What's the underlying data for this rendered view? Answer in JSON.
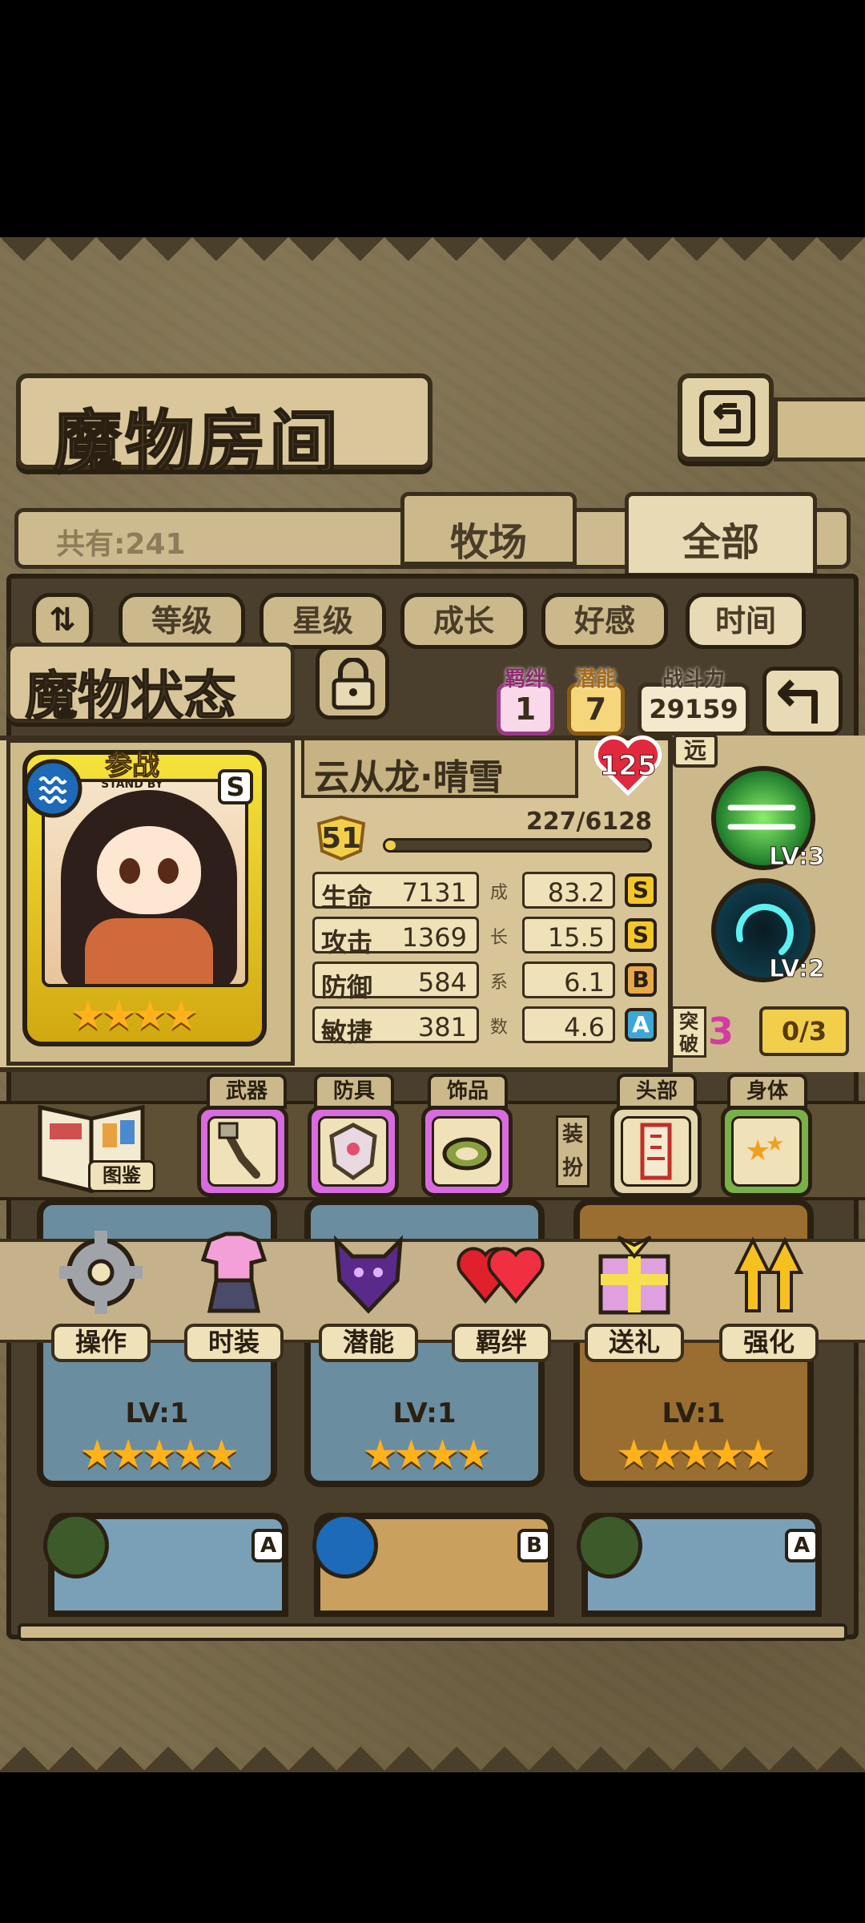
{
  "header": {
    "title": "魔物房间"
  },
  "collection": {
    "count_label": "共有:241"
  },
  "tabs": [
    {
      "label": "牧场"
    },
    {
      "label": "全部"
    }
  ],
  "sort": {
    "options": [
      "等级",
      "星级",
      "成长",
      "好感",
      "时间"
    ],
    "active": "时间"
  },
  "status": {
    "title": "魔物状态",
    "bond_label": "羁绊",
    "bond_value": "1",
    "potential_label": "潜能",
    "potential_value": "7",
    "power_label": "战斗力",
    "power_value": "29159"
  },
  "monster": {
    "name": "云从龙·晴雪",
    "affection": "125",
    "level": "51",
    "exp": "227/6128",
    "exp_fraction": 0.037,
    "standby_label": "参战",
    "standby_sub": "STAND BY",
    "rank": "S",
    "stars": "★★★★",
    "range": "远",
    "stats": [
      {
        "name": "生命",
        "value": "7131",
        "growth": "83.2",
        "grade": "S"
      },
      {
        "name": "攻击",
        "value": "1369",
        "growth": "15.5",
        "grade": "S"
      },
      {
        "name": "防御",
        "value": "584",
        "growth": "6.1",
        "grade": "B"
      },
      {
        "name": "敏捷",
        "value": "381",
        "growth": "4.6",
        "grade": "A"
      }
    ],
    "growth_label_chars": [
      "成",
      "长",
      "系",
      "数"
    ],
    "skills": [
      {
        "level": "LV:3"
      },
      {
        "level": "LV:2"
      }
    ],
    "breakthrough": {
      "label": "突破",
      "value": "3",
      "progress": "0/3"
    }
  },
  "equipment": {
    "book_label": "图鉴",
    "slots": [
      "武器",
      "防具",
      "饰品"
    ],
    "outfit_label": "装扮",
    "outfit_slots": [
      "头部",
      "身体"
    ]
  },
  "actions": [
    "操作",
    "时装",
    "潜能",
    "羁绊",
    "送礼",
    "强化"
  ],
  "list": {
    "cards": [
      {
        "level": "LV:1",
        "stars": "★★★★★"
      },
      {
        "level": "LV:1",
        "stars": "★★★★"
      },
      {
        "level": "LV:1",
        "stars": "★★★★★"
      }
    ],
    "bottom_ranks": [
      "A",
      "B",
      "A"
    ]
  },
  "colors": {
    "accent_gold": "#f3c62a",
    "panel": "#d7c597",
    "border": "#3a2e1c"
  }
}
